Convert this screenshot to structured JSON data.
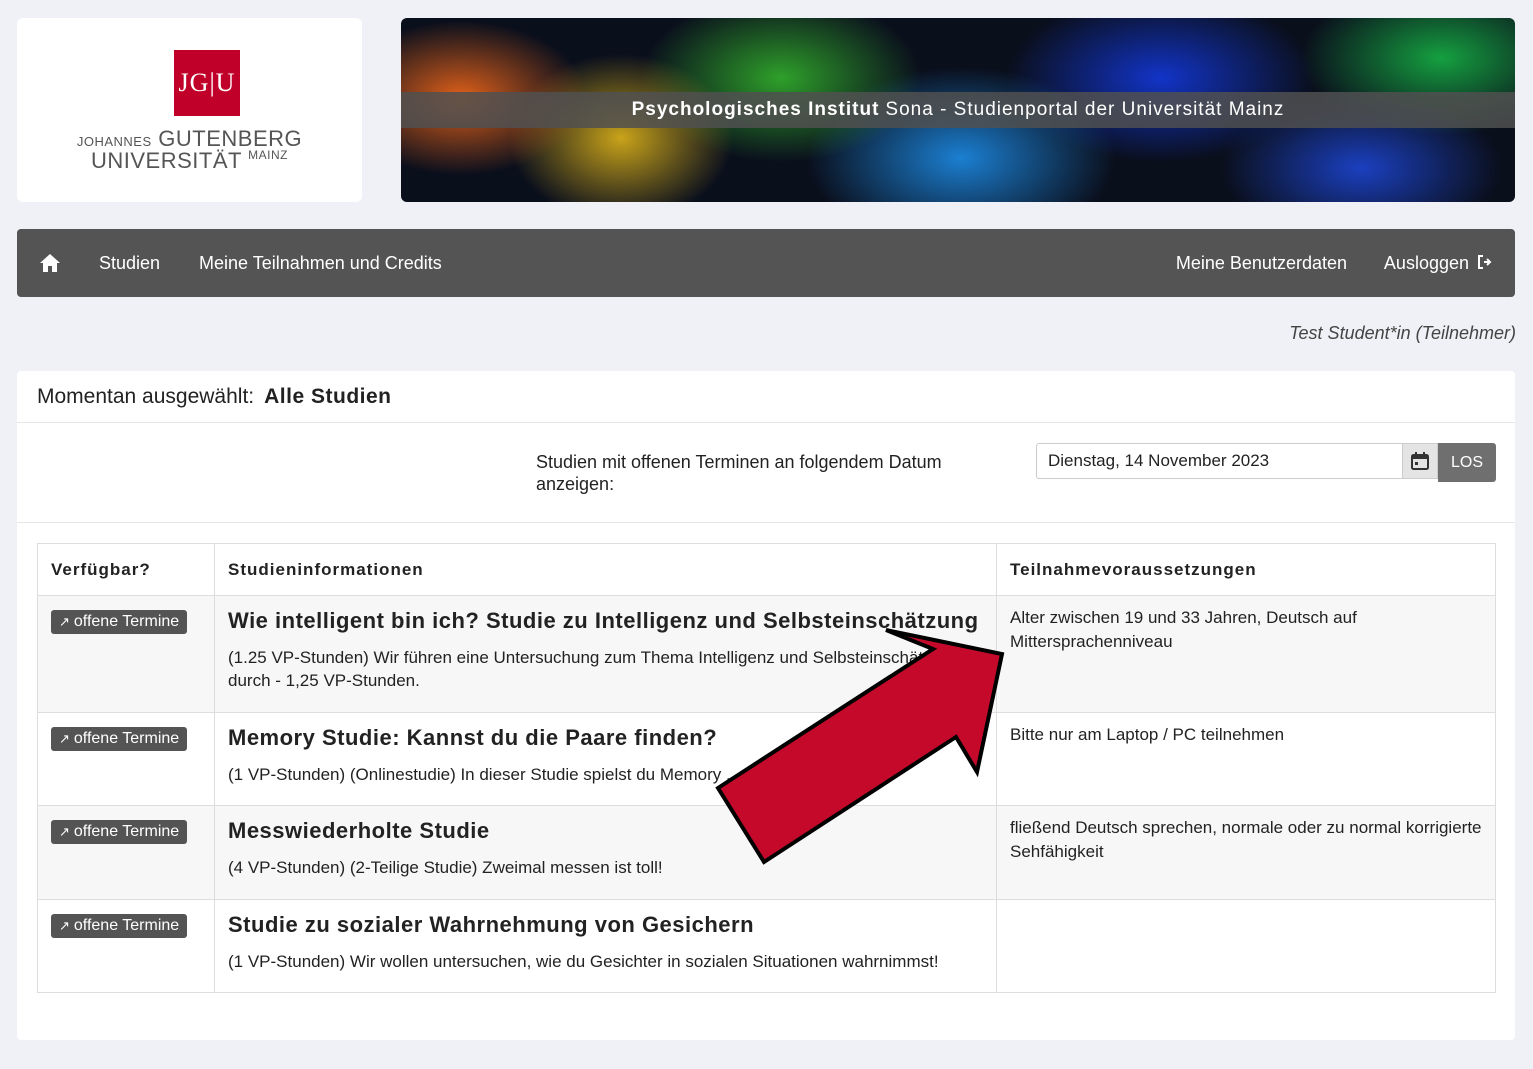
{
  "logo": {
    "mark": "JG|U",
    "line1_small": "JOHANNES",
    "line1_big": "GUTENBERG",
    "line2_big": "UNIVERSITÄT",
    "line2_small": "MAINZ"
  },
  "banner": {
    "title_bold": "Psychologisches Institut",
    "title_rest": "Sona - Studienportal der Universität Mainz"
  },
  "nav": {
    "home_icon": "home-icon",
    "studien": "Studien",
    "teilnahmen": "Meine Teilnahmen und Credits",
    "benutzerdaten": "Meine Benutzerdaten",
    "ausloggen": "Ausloggen"
  },
  "user_label": "Test Student*in (Teilnehmer)",
  "selection": {
    "label": "Momentan ausgewählt:",
    "value": "Alle Studien"
  },
  "date_filter": {
    "label": "Studien mit offenen Terminen an folgendem Datum anzeigen:",
    "value": "Dienstag, 14 November 2023",
    "button": "LOS"
  },
  "table": {
    "headers": [
      "Verfügbar?",
      "Studieninformationen",
      "Teilnahmevoraussetzungen"
    ],
    "rows": [
      {
        "badge": "offene Termine",
        "title": "Wie intelligent bin ich? Studie zu Intelligenz und Selbsteinschätzung",
        "desc": "(1.25 VP-Stunden) Wir führen eine Untersuchung zum Thema Intelligenz und Selbsteinschätzung durch - 1,25 VP-Stunden.",
        "req": "Alter zwischen 19 und 33 Jahren, Deutsch auf Mittersprachenniveau"
      },
      {
        "badge": "offene Termine",
        "title": "Memory Studie: Kannst du die Paare finden?",
        "desc": "(1 VP-Stunden) (Onlinestudie) In dieser Studie spielst du Memory ... ter",
        "req": "Bitte nur am Laptop / PC teilnehmen"
      },
      {
        "badge": "offene Termine",
        "title": "Messwiederholte Studie",
        "desc": "(4 VP-Stunden) (2-Teilige Studie) Zweimal messen ist toll!",
        "req": "fließend Deutsch sprechen, normale oder zu normal korrigierte Sehfähigkeit"
      },
      {
        "badge": "offene Termine",
        "title": "Studie zu sozialer Wahrnehmung von Gesichern",
        "desc": "(1 VP-Stunden) Wir wollen untersuchen, wie du Gesichter in sozialen Situationen wahrnimmst!",
        "req": ""
      }
    ]
  },
  "colors": {
    "navbar": "#545454",
    "arrow": "#c4092a",
    "background": "#f0f1f6"
  }
}
